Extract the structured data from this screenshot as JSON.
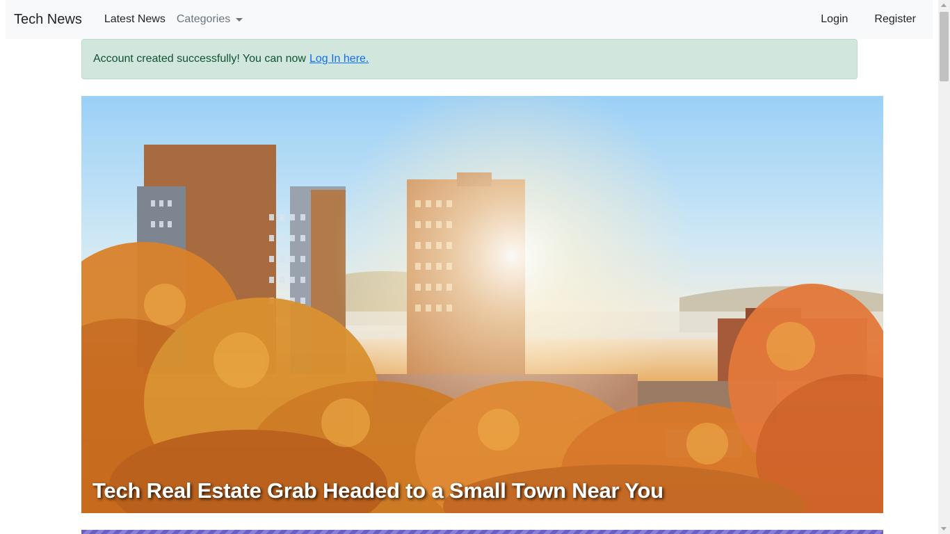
{
  "navbar": {
    "brand": "Tech News",
    "links": {
      "latest": "Latest News",
      "categories": "Categories"
    },
    "right": {
      "login": "Login",
      "register": "Register"
    }
  },
  "alert": {
    "message": "Account created successfully! You can now",
    "link": "Log In here."
  },
  "hero": {
    "title": "Tech Real Estate Grab Headed to a Small Town Near You"
  },
  "colors": {
    "navbar_bg": "#f8f9fa",
    "alert_bg": "#d1e7dd",
    "link": "#0d6efd"
  }
}
